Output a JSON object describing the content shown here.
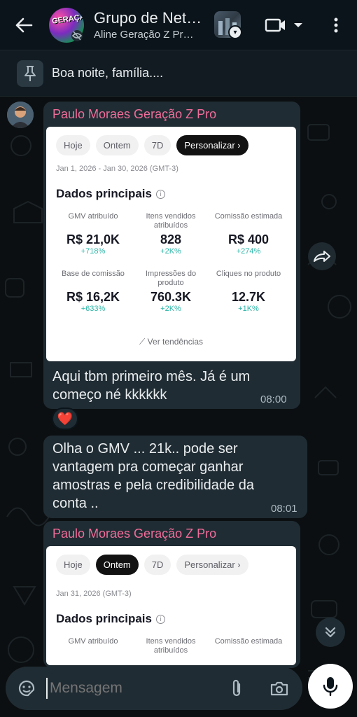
{
  "header": {
    "title": "Grupo de Net…",
    "subtitle": "Aline Geração Z Pr…",
    "avatar_text": "GERAÇÃO"
  },
  "pinned": {
    "text": "Boa noite, família...."
  },
  "messages": [
    {
      "sender": "Paulo Moraes Geração Z Pro",
      "card": {
        "chips": [
          "Hoje",
          "Ontem",
          "7D",
          "Personalizar"
        ],
        "active_chip": "Personalizar",
        "date_range": "Jan 1, 2026 - Jan 30, 2026 (GMT-3)",
        "section_title": "Dados principais",
        "metrics": [
          {
            "label": "GMV atribuído",
            "value": "R$ 21,0K",
            "change": "+718%"
          },
          {
            "label": "Itens vendidos atribuídos",
            "value": "828",
            "change": "+2K%"
          },
          {
            "label": "Comissão estimada",
            "value": "R$ 400",
            "change": "+274%"
          },
          {
            "label": "Base de comissão",
            "value": "R$ 16,2K",
            "change": "+633%"
          },
          {
            "label": "Impressões do produto",
            "value": "760.3K",
            "change": "+2K%"
          },
          {
            "label": "Cliques no produto",
            "value": "12.7K",
            "change": "+1K%"
          }
        ],
        "trend_link": "Ver tendências"
      },
      "text_line1": "Aqui tbm primeiro mês. Já é um",
      "text_line2": "começo né kkkkkk",
      "time": "08:00",
      "reaction": "❤️"
    },
    {
      "text_line1": "Olha o GMV ... 21k.. pode ser",
      "text_line2": "vantagem pra começar ganhar",
      "text_line3": "amostras e pela credibilidade da",
      "text_line4": "conta ..",
      "time": "08:01"
    },
    {
      "sender": "Paulo Moraes Geração Z Pro",
      "card": {
        "chips": [
          "Hoje",
          "Ontem",
          "7D",
          "Personalizar"
        ],
        "active_chip": "Ontem",
        "date_range": "Jan 31, 2026 (GMT-3)",
        "section_title": "Dados principais",
        "metrics": [
          {
            "label": "GMV atribuído"
          },
          {
            "label": "Itens vendidos atribuídos"
          },
          {
            "label": "Comissão estimada"
          }
        ]
      }
    }
  ],
  "input": {
    "placeholder": "Mensagem"
  },
  "colors": {
    "sender_name": "#f06d9a",
    "bubble": "#202c33",
    "change_positive": "#2bb6a8",
    "background": "#0b141a"
  }
}
